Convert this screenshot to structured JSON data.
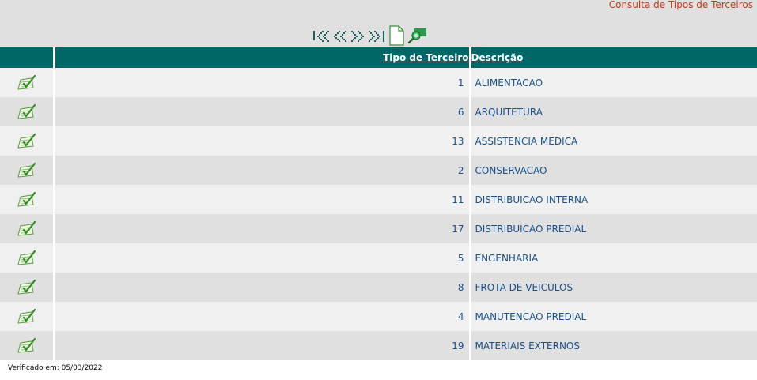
{
  "header": {
    "title": "Consulta de Tipos de Terceiros"
  },
  "toolbar": {
    "buttons": [
      {
        "name": "first-page-icon"
      },
      {
        "name": "previous-page-icon"
      },
      {
        "name": "next-page-icon"
      },
      {
        "name": "last-page-icon"
      },
      {
        "name": "new-document-icon"
      },
      {
        "name": "search-icon"
      }
    ]
  },
  "table": {
    "columns": {
      "id": "Tipo de Terceiro",
      "description": "Descrição"
    },
    "rows": [
      {
        "id": "1",
        "description": "ALIMENTACAO"
      },
      {
        "id": "6",
        "description": "ARQUITETURA"
      },
      {
        "id": "13",
        "description": "ASSISTENCIA MEDICA"
      },
      {
        "id": "2",
        "description": "CONSERVACAO"
      },
      {
        "id": "11",
        "description": "DISTRIBUICAO INTERNA"
      },
      {
        "id": "17",
        "description": "DISTRIBUICAO PREDIAL"
      },
      {
        "id": "5",
        "description": "ENGENHARIA"
      },
      {
        "id": "8",
        "description": "FROTA DE VEICULOS"
      },
      {
        "id": "4",
        "description": "MANUTENCAO PREDIAL"
      },
      {
        "id": "19",
        "description": "MATERIAIS EXTERNOS"
      }
    ]
  },
  "footer": {
    "verified": "Verificado em: 05/03/2022"
  },
  "colors": {
    "header_bg": "#006666",
    "row_odd": "#f0f0f0",
    "row_even": "#e0e0e0",
    "title": "#c0391b",
    "cell_text": "#1a4f8a"
  }
}
